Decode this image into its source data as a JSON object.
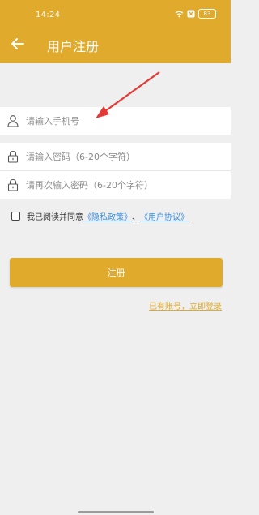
{
  "status_bar": {
    "time": "14:24",
    "battery": "83"
  },
  "header": {
    "title": "用户注册",
    "back_icon": "back-arrow-icon"
  },
  "form": {
    "phone_placeholder": "请输入手机号",
    "password_placeholder": "请输入密码（6-20个字符）",
    "confirm_password_placeholder": "请再次输入密码（6-20个字符）"
  },
  "agreement": {
    "prefix": "我已阅读并同意",
    "privacy_link": "《隐私政策》",
    "separator": "、",
    "user_link": "《用户协议》"
  },
  "register_label": "注册",
  "login_link": "已有账号，立即登录",
  "colors": {
    "accent": "#e0ab2c",
    "link": "#3a8fe0",
    "annotation_arrow": "#e53935"
  }
}
